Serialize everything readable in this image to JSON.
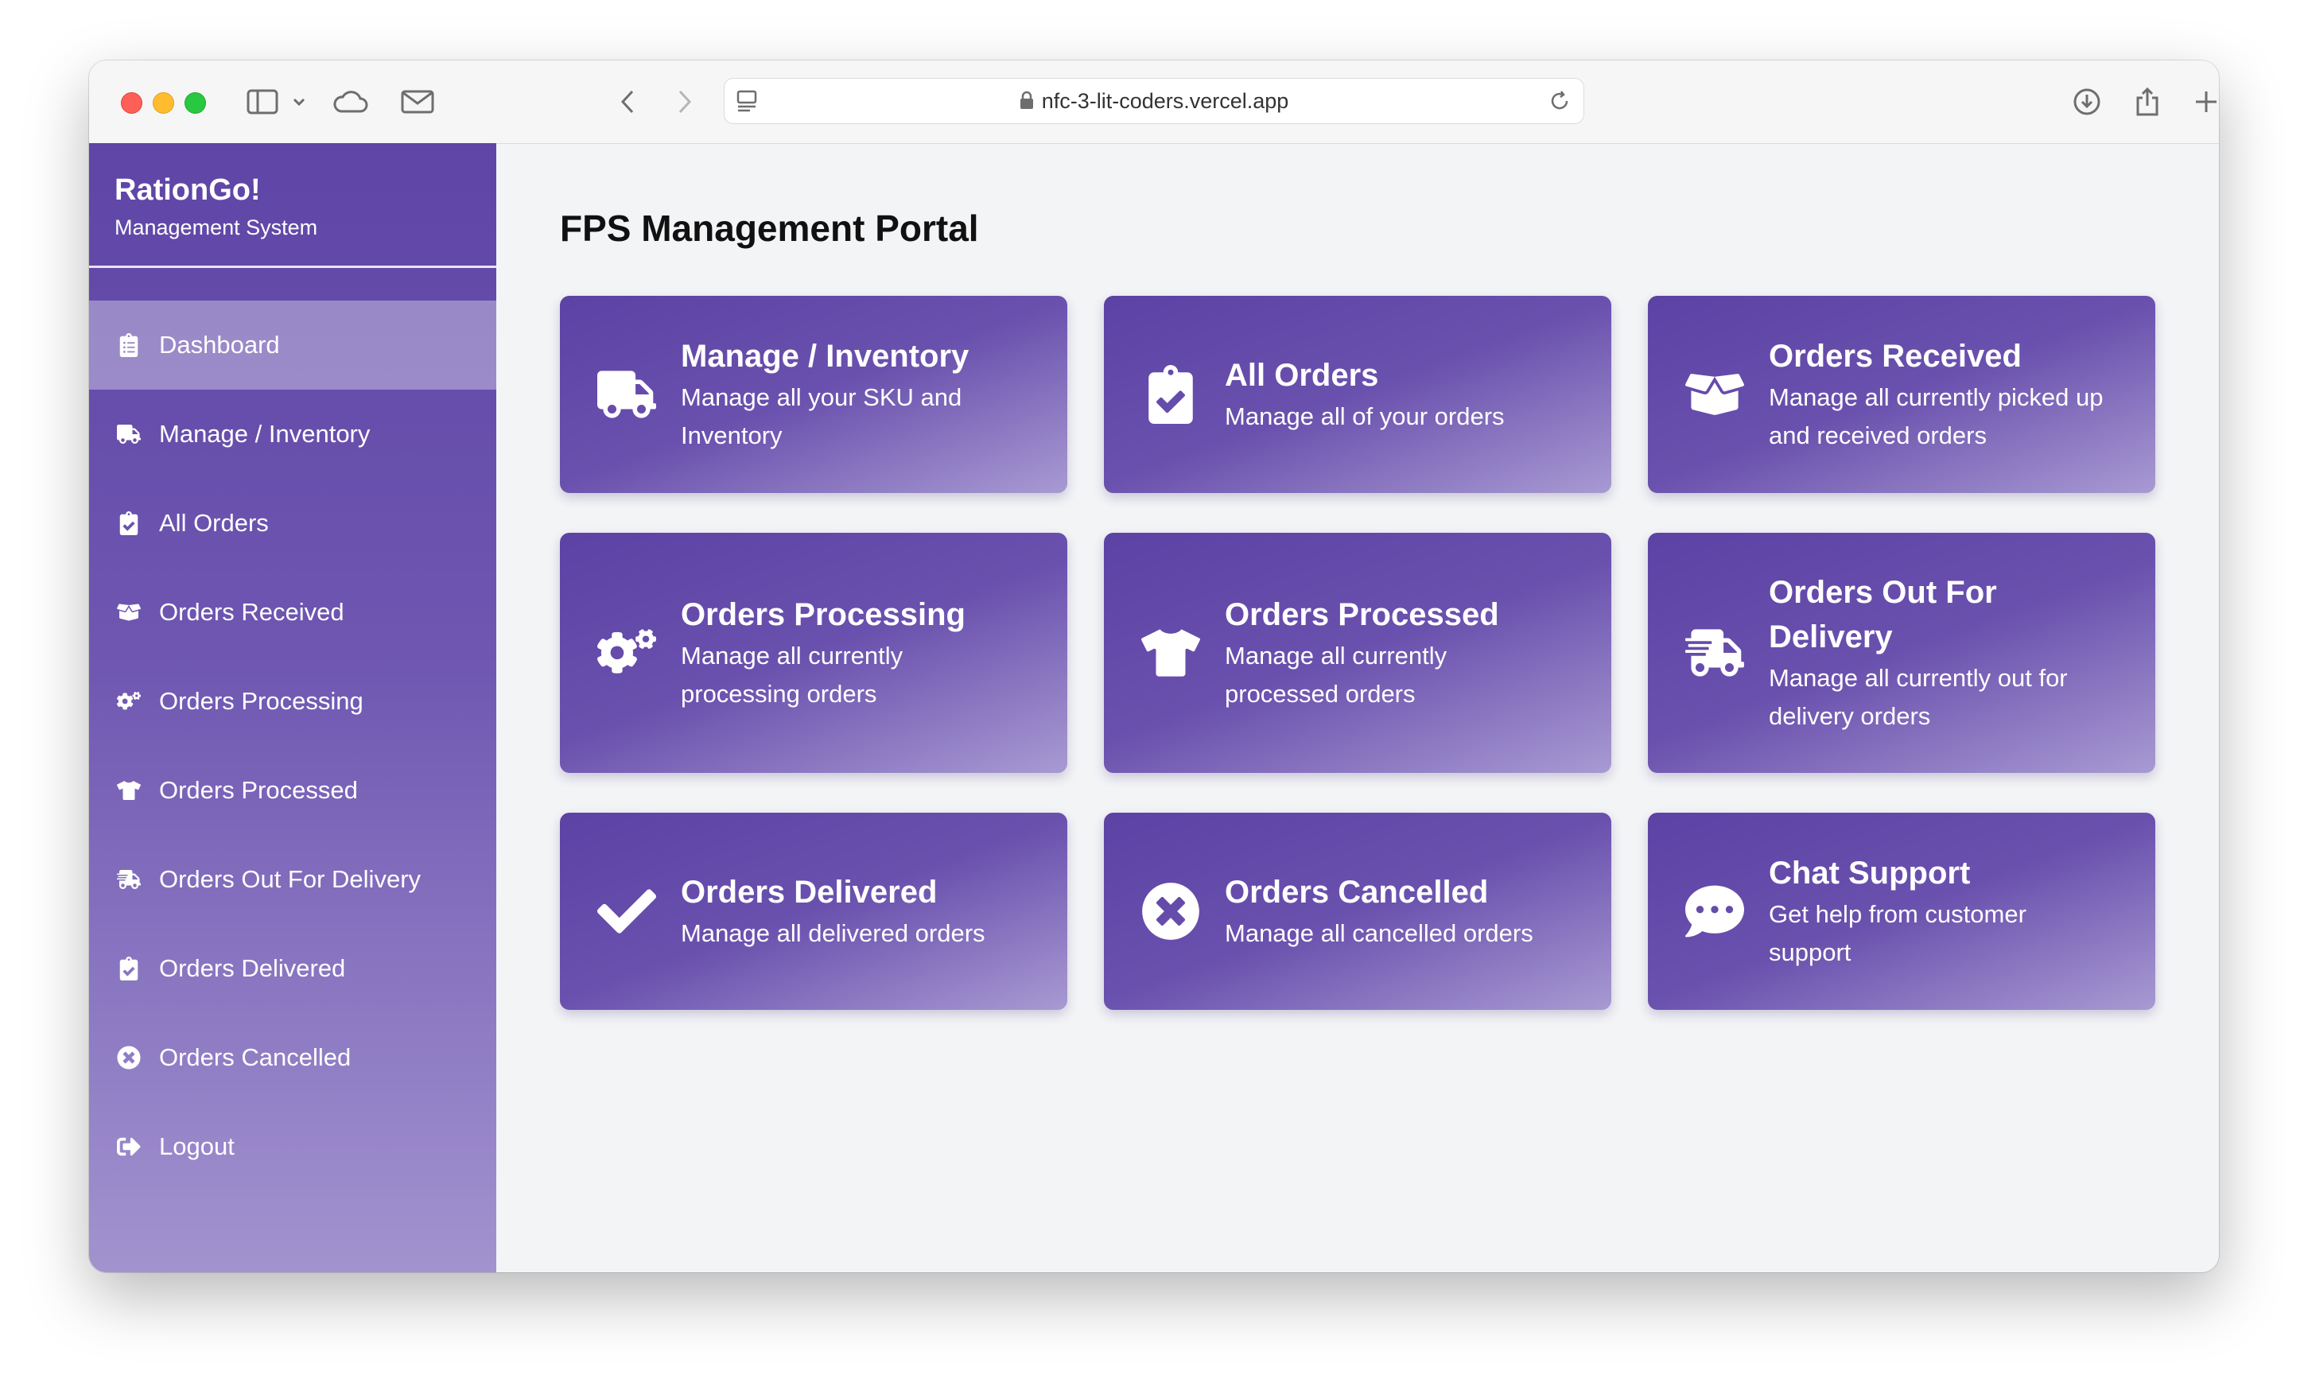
{
  "browser": {
    "url": "nfc-3-lit-coders.vercel.app"
  },
  "sidebar": {
    "brand_title": "RationGo!",
    "brand_subtitle": "Management System",
    "items": [
      {
        "label": "Dashboard",
        "icon": "clipboard-list-icon",
        "active": true
      },
      {
        "label": "Manage / Inventory",
        "icon": "truck-icon"
      },
      {
        "label": "All Orders",
        "icon": "clipboard-check-icon"
      },
      {
        "label": "Orders Received",
        "icon": "box-open-icon"
      },
      {
        "label": "Orders Processing",
        "icon": "cogs-icon"
      },
      {
        "label": "Orders Processed",
        "icon": "tshirt-icon"
      },
      {
        "label": "Orders Out For Delivery",
        "icon": "shipping-fast-icon"
      },
      {
        "label": "Orders Delivered",
        "icon": "clipboard-check-icon"
      },
      {
        "label": "Orders Cancelled",
        "icon": "times-circle-icon"
      },
      {
        "label": "Logout",
        "icon": "sign-out-icon"
      }
    ]
  },
  "main": {
    "title": "FPS Management Portal",
    "cards": [
      {
        "title": "Manage / Inventory",
        "desc": "Manage all your SKU and Inventory",
        "icon": "truck-icon"
      },
      {
        "title": "All Orders",
        "desc": "Manage all of your orders",
        "icon": "clipboard-check-icon"
      },
      {
        "title": "Orders Received",
        "desc": "Manage all currently picked up and received orders",
        "icon": "box-open-icon"
      },
      {
        "title": "Orders Processing",
        "desc": "Manage all currently processing orders",
        "icon": "cogs-icon"
      },
      {
        "title": "Orders Processed",
        "desc": "Manage all currently processed orders",
        "icon": "tshirt-icon"
      },
      {
        "title": "Orders Out For Delivery",
        "desc": "Manage all currently out for delivery orders",
        "icon": "shipping-fast-icon"
      },
      {
        "title": "Orders Delivered",
        "desc": "Manage all delivered orders",
        "icon": "check-icon"
      },
      {
        "title": "Orders Cancelled",
        "desc": "Manage all cancelled orders",
        "icon": "times-circle-icon"
      },
      {
        "title": "Chat Support",
        "desc": "Get help from customer support",
        "icon": "comment-dots-icon"
      }
    ]
  },
  "colors": {
    "accent": "#5f45a6",
    "accent_light": "#a293cf",
    "background": "#f3f4f6"
  }
}
